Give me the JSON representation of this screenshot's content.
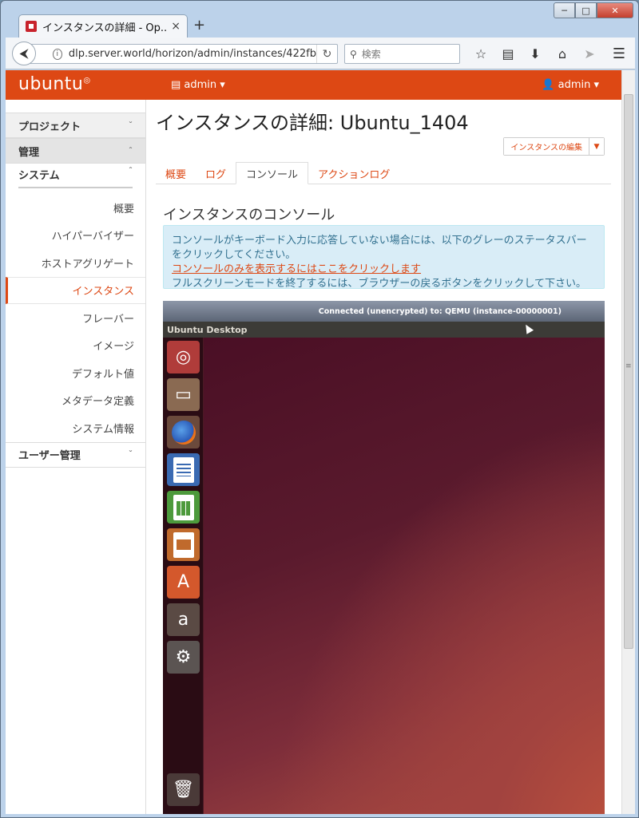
{
  "browser": {
    "tab_title": "インスタンスの詳細 - Op...",
    "tab_close": "×",
    "new_tab": "+",
    "url": "dlp.server.world/horizon/admin/instances/422fb",
    "search_placeholder": "検索",
    "controls": {
      "minimize": "─",
      "maximize": "□",
      "close": "✕"
    }
  },
  "header": {
    "logo": "ubuntu",
    "project_menu": "admin ▾",
    "user_menu": "admin ▾",
    "accent_color": "#dd4814"
  },
  "sidebar": {
    "sections": [
      {
        "label": "プロジェクト",
        "chevron": "ˇ"
      },
      {
        "label": "管理",
        "chevron": "ˆ"
      }
    ],
    "system_label": "システム",
    "items": [
      "概要",
      "ハイパーバイザー",
      "ホストアグリゲート",
      "インスタンス",
      "フレーバー",
      "イメージ",
      "デフォルト値",
      "メタデータ定義",
      "システム情報"
    ],
    "active_item": "インスタンス",
    "user_section": "ユーザー管理"
  },
  "main": {
    "title": "インスタンスの詳細: Ubuntu_1404",
    "edit_button": "インスタンスの編集",
    "tabs": [
      "概要",
      "ログ",
      "コンソール",
      "アクションログ"
    ],
    "active_tab": "コンソール",
    "console_heading": "インスタンスのコンソール",
    "info_line1": "コンソールがキーボード入力に応答していない場合には、以下のグレーのステータスバーをクリックしてください。",
    "info_link": "コンソールのみを表示するにはここをクリックします",
    "info_line3": "フルスクリーンモードを終了するには、ブラウザーの戻るボタンをクリックして下さい。"
  },
  "console": {
    "vnc_status": "Connected (unencrypted) to: QEMU (instance-00000001)",
    "desktop_title": "Ubuntu Desktop",
    "launcher_icons": [
      "dash-home-icon",
      "files-icon",
      "firefox-icon",
      "libreoffice-writer-icon",
      "libreoffice-calc-icon",
      "libreoffice-impress-icon",
      "software-center-icon",
      "amazon-icon",
      "system-settings-icon",
      "trash-icon"
    ]
  }
}
